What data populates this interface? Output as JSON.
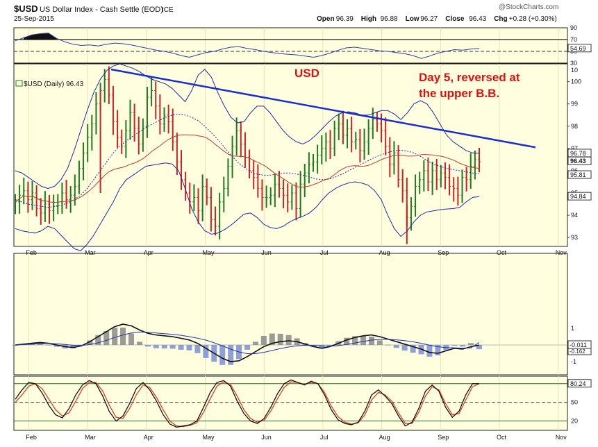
{
  "header": {
    "symbol": "$USD",
    "name": "US Dollar Index - Cash Settle (EOD)",
    "exchange": "ICE",
    "date": "25-Sep-2015",
    "open_label": "Open",
    "open": "96.39",
    "high_label": "High",
    "high": "96.88",
    "low_label": "Low",
    "low": "96.27",
    "close_label": "Close",
    "close": "96.43",
    "chg_label": "Chg",
    "chg": "+0.28 (+0.30%)",
    "watermark": "@StockCharts.com",
    "series_label": "$USD (Daily) 96.43"
  },
  "annotations": {
    "usd": "USD",
    "note_line1": "Day 5, reversed at",
    "note_line2": "the upper B.B."
  },
  "colors": {
    "panel_bg": "#ffffe0",
    "frame": "#1c1c1c",
    "up_bar": "#1f7a1f",
    "down_bar": "#cc2222",
    "bollinger": "#1c2a9e",
    "ma_red": "#c0392b",
    "trendline": "#1a2ecc",
    "annotation": "#dd1111",
    "macd_hist": "#7b8fd6",
    "rsi_line": "#2f3fa0"
  },
  "chart_data": [
    {
      "type": "line",
      "title": "RSI",
      "ylim": [
        30,
        90
      ],
      "ticks": [
        "90",
        "70",
        "50",
        "30"
      ],
      "current_label": "54.69",
      "values": [
        68,
        73,
        78,
        80,
        81,
        72,
        66,
        62,
        60,
        61,
        59,
        62,
        64,
        63,
        61,
        58,
        55,
        52,
        50,
        47,
        43,
        40,
        44,
        48,
        50,
        54,
        57,
        58,
        55,
        53,
        50,
        48,
        46,
        45,
        44,
        42,
        40,
        43,
        47,
        52,
        56,
        57,
        55,
        53,
        51,
        50,
        48,
        46,
        43,
        38,
        42,
        47,
        50,
        53,
        52,
        54,
        55
      ]
    },
    {
      "type": "bar",
      "title": "$USD (Daily) 96.43",
      "ylim": [
        92.6,
        100.8
      ],
      "y_ticks": [
        "100",
        "99",
        "98",
        "97",
        "96",
        "95",
        "94",
        "93"
      ],
      "months": [
        "Feb",
        "Mar",
        "Apr",
        "May",
        "Jun",
        "Jul",
        "Aug",
        "Sep",
        "Oct",
        "Nov"
      ],
      "price_labels": [
        {
          "text": "96.78",
          "value": 96.78
        },
        {
          "text": "96.43",
          "value": 96.43
        },
        {
          "text": "95.81",
          "value": 95.81
        },
        {
          "text": "94.84",
          "value": 94.84
        }
      ],
      "trendline": {
        "from": [
          "Mar 13",
          100.55
        ],
        "to": [
          "Oct 28",
          97.05
        ]
      },
      "close": [
        94.6,
        94.9,
        95.1,
        94.7,
        95.0,
        94.3,
        94.1,
        94.5,
        94.2,
        94.4,
        94.6,
        95.0,
        94.7,
        94.9,
        95.3,
        96.1,
        96.8,
        97.5,
        98.1,
        99.0,
        99.6,
        100.1,
        99.4,
        98.2,
        97.5,
        97.1,
        97.8,
        98.6,
        97.9,
        97.2,
        98.0,
        99.3,
        99.6,
        98.9,
        98.1,
        98.5,
        98.2,
        97.3,
        96.4,
        95.6,
        95.0,
        94.6,
        94.8,
        94.2,
        95.3,
        94.8,
        93.8,
        93.5,
        94.6,
        95.2,
        96.2,
        97.1,
        97.8,
        97.2,
        96.6,
        96.0,
        95.7,
        95.2,
        94.8,
        94.8,
        94.9,
        95.4,
        95.2,
        94.9,
        94.6,
        95.0,
        94.3,
        95.4,
        95.9,
        96.3,
        96.4,
        96.7,
        97.0,
        97.3,
        97.0,
        97.9,
        98.1,
        97.6,
        97.9,
        97.3,
        97.4,
        96.9,
        97.3,
        97.9,
        98.3,
        98.1,
        97.8,
        97.1,
        96.3,
        96.8,
        95.6,
        95.1,
        93.9,
        94.4,
        95.3,
        95.6,
        96.0,
        95.5,
        96.0,
        95.6,
        95.9,
        95.7,
        95.3,
        95.2,
        94.9,
        95.7,
        95.6,
        96.2,
        96.5,
        96.4
      ],
      "ma20": [
        94.7,
        94.6,
        94.5,
        94.45,
        94.4,
        94.35,
        94.4,
        94.45,
        94.55,
        94.7,
        94.9,
        95.2,
        95.6,
        96.0,
        96.4,
        96.8,
        97.1,
        97.35,
        97.55,
        97.75,
        97.95,
        98.1,
        98.25,
        98.4,
        98.5,
        98.55,
        98.5,
        98.4,
        98.25,
        98.0,
        97.7,
        97.4,
        97.05,
        96.7,
        96.4,
        96.15,
        95.95,
        95.85,
        95.8,
        95.8,
        95.85,
        95.9,
        95.9,
        95.85,
        95.8,
        95.72,
        95.63,
        95.6,
        95.62,
        95.72,
        95.85,
        96.0,
        96.15,
        96.3,
        96.45,
        96.6,
        96.72,
        96.82,
        96.9,
        96.92,
        96.88,
        96.8,
        96.65,
        96.45,
        96.3,
        96.2,
        96.1,
        96.05,
        96.0,
        95.95,
        95.9,
        95.86
      ],
      "upper_band": [
        96.0,
        95.9,
        95.7,
        95.5,
        95.3,
        95.2,
        95.3,
        95.6,
        96.1,
        96.9,
        97.8,
        98.7,
        99.5,
        100.1,
        100.5,
        100.7,
        100.8,
        100.7,
        100.6,
        100.45,
        100.25,
        100.1,
        100.0,
        99.9,
        99.7,
        99.4,
        99.1,
        99.6,
        100.3,
        100.55,
        100.2,
        99.5,
        98.9,
        98.4,
        98.15,
        98.2,
        98.6,
        98.9,
        98.9,
        98.6,
        98.2,
        97.8,
        97.5,
        97.3,
        97.2,
        97.35,
        97.6,
        97.9,
        98.2,
        98.45,
        98.6,
        98.65,
        98.6,
        98.5,
        98.5,
        98.6,
        98.7,
        98.7,
        98.55,
        98.3,
        98.6,
        99.0,
        99.15,
        99.0,
        98.6,
        98.1,
        97.6,
        97.3,
        97.1,
        96.9,
        96.8,
        96.78
      ],
      "lower_band": [
        93.4,
        93.3,
        93.25,
        93.2,
        93.3,
        93.5,
        93.4,
        93.1,
        92.8,
        92.5,
        92.4,
        92.7,
        93.1,
        93.6,
        94.1,
        94.6,
        95.2,
        95.6,
        95.8,
        96.0,
        96.2,
        96.25,
        96.3,
        96.35,
        96.3,
        96.0,
        95.2,
        94.3,
        93.7,
        93.3,
        93.15,
        93.2,
        93.35,
        93.55,
        93.8,
        94.05,
        94.1,
        93.9,
        93.6,
        93.45,
        93.4,
        93.5,
        93.7,
        93.85,
        93.95,
        94.1,
        94.35,
        94.7,
        95.0,
        95.2,
        95.35,
        95.45,
        95.5,
        95.45,
        95.35,
        95.1,
        94.7,
        94.0,
        93.4,
        93.05,
        93.3,
        93.7,
        94.0,
        94.15,
        94.2,
        94.25,
        94.28,
        94.3,
        94.35,
        94.6,
        94.8,
        94.84
      ]
    },
    {
      "type": "line",
      "title": "MACD",
      "ylim": [
        -1.4,
        1.4
      ],
      "ticks": [
        "1",
        "0",
        "-1"
      ],
      "current_label": "-0.011",
      "hist_label": "-0.162",
      "macd": [
        0.0,
        0.05,
        0.1,
        0.15,
        0.1,
        0.0,
        -0.1,
        -0.15,
        -0.05,
        0.2,
        0.5,
        0.8,
        1.1,
        1.25,
        1.15,
        0.9,
        0.7,
        0.6,
        0.55,
        0.5,
        0.4,
        0.3,
        0.1,
        -0.2,
        -0.5,
        -0.8,
        -1.0,
        -0.95,
        -0.7,
        -0.4,
        -0.1,
        0.1,
        0.2,
        0.25,
        0.2,
        0.05,
        -0.1,
        -0.2,
        -0.1,
        0.1,
        0.3,
        0.45,
        0.55,
        0.6,
        0.5,
        0.35,
        0.2,
        0.05,
        -0.1,
        -0.25,
        -0.45,
        -0.5,
        -0.35,
        -0.2,
        -0.25,
        -0.1,
        -0.011
      ],
      "signal": [
        0.0,
        0.02,
        0.05,
        0.08,
        0.09,
        0.07,
        0.03,
        -0.02,
        -0.03,
        0.03,
        0.13,
        0.28,
        0.45,
        0.6,
        0.72,
        0.78,
        0.76,
        0.72,
        0.68,
        0.64,
        0.58,
        0.5,
        0.41,
        0.29,
        0.13,
        -0.05,
        -0.25,
        -0.42,
        -0.52,
        -0.52,
        -0.44,
        -0.33,
        -0.22,
        -0.12,
        -0.05,
        -0.02,
        -0.03,
        -0.06,
        -0.07,
        -0.04,
        0.03,
        0.12,
        0.21,
        0.29,
        0.33,
        0.34,
        0.31,
        0.26,
        0.19,
        0.1,
        -0.01,
        -0.11,
        -0.16,
        -0.17,
        -0.19,
        -0.17,
        0.15
      ]
    },
    {
      "type": "line",
      "title": "Stochastic",
      "ylim": [
        5,
        92
      ],
      "ticks": [
        "80",
        "50",
        "20"
      ],
      "current_label": "80.24",
      "k": [
        55,
        70,
        82,
        80,
        65,
        45,
        30,
        25,
        40,
        62,
        78,
        85,
        80,
        60,
        35,
        20,
        28,
        48,
        72,
        82,
        70,
        52,
        30,
        15,
        10,
        12,
        14,
        20,
        42,
        66,
        82,
        85,
        76,
        52,
        32,
        20,
        16,
        24,
        42,
        64,
        80,
        86,
        82,
        78,
        84,
        80,
        62,
        38,
        22,
        16,
        14,
        18,
        36,
        62,
        70,
        60,
        48,
        28,
        12,
        18,
        40,
        68,
        78,
        68,
        42,
        26,
        36,
        62,
        80,
        80
      ],
      "d": [
        50,
        62,
        76,
        80,
        72,
        55,
        38,
        28,
        33,
        52,
        72,
        82,
        82,
        68,
        45,
        26,
        24,
        40,
        62,
        78,
        74,
        58,
        38,
        20,
        12,
        11,
        13,
        17,
        34,
        56,
        76,
        83,
        79,
        60,
        38,
        24,
        18,
        21,
        36,
        56,
        74,
        83,
        82,
        79,
        82,
        80,
        66,
        44,
        27,
        18,
        15,
        17,
        30,
        54,
        66,
        62,
        52,
        33,
        16,
        16,
        34,
        60,
        75,
        70,
        48,
        30,
        32,
        54,
        75,
        80
      ]
    }
  ]
}
